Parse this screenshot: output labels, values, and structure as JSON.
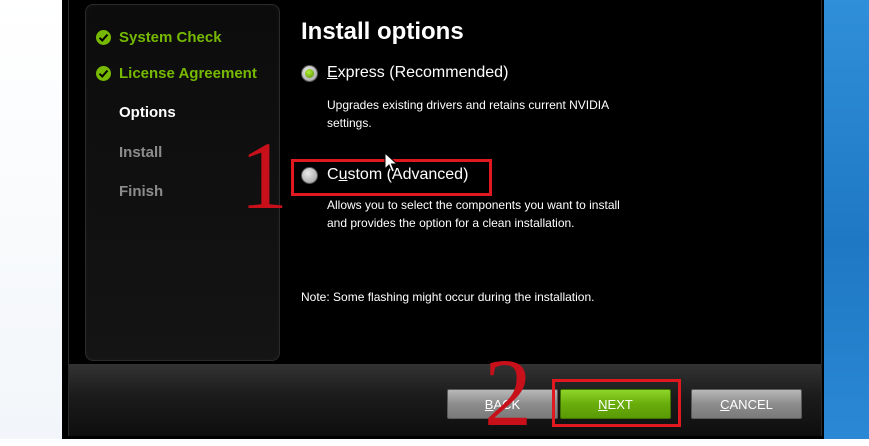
{
  "installer": {
    "steps": [
      {
        "label": "System Check",
        "state": "done"
      },
      {
        "label": "License Agreement",
        "state": "done"
      },
      {
        "label": "Options",
        "state": "current"
      },
      {
        "label": "Install",
        "state": "pending"
      },
      {
        "label": "Finish",
        "state": "pending"
      }
    ],
    "title": "Install options",
    "options": [
      {
        "label": "Express (Recommended)",
        "mnemonic": "E",
        "description": [
          "Upgrades existing drivers and retains current NVIDIA",
          "settings."
        ],
        "selected": true
      },
      {
        "label": "Custom (Advanced)",
        "mnemonic": "u",
        "description": [
          "Allows you to select the components you want to install",
          "and provides the option for a clean installation."
        ],
        "selected": false
      }
    ],
    "note": "Note: Some flashing might occur during the installation.",
    "buttons": {
      "back": "BACK",
      "next": "NEXT",
      "cancel": "CANCEL"
    }
  },
  "annotations": {
    "step1": "1",
    "step2": "2"
  },
  "colors": {
    "nvidia_green": "#76b900",
    "annotation_red": "#e01820",
    "background": "#000000"
  },
  "icons": [
    "check-icon",
    "radio-selected-icon",
    "radio-unselected-icon",
    "mouse-cursor-icon"
  ]
}
